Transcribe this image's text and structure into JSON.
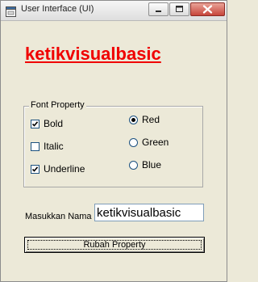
{
  "window": {
    "title": "User Interface (UI)",
    "icons": {
      "app": "app-window-icon",
      "minimize": "minimize-icon",
      "maximize": "maximize-icon",
      "close": "close-icon"
    }
  },
  "main": {
    "heading": "ketikvisualbasic",
    "heading_color": "#f00000"
  },
  "font_property": {
    "legend": "Font Property",
    "checkboxes": [
      {
        "label": "Bold",
        "checked": true
      },
      {
        "label": "Italic",
        "checked": false
      },
      {
        "label": "Underline",
        "checked": true
      }
    ],
    "radios": [
      {
        "label": "Red",
        "selected": true
      },
      {
        "label": "Green",
        "selected": false
      },
      {
        "label": "Blue",
        "selected": false
      }
    ]
  },
  "form": {
    "name_label": "Masukkan Nama",
    "name_value": "ketikvisualbasic"
  },
  "actions": {
    "submit_label": "Rubah Property"
  }
}
